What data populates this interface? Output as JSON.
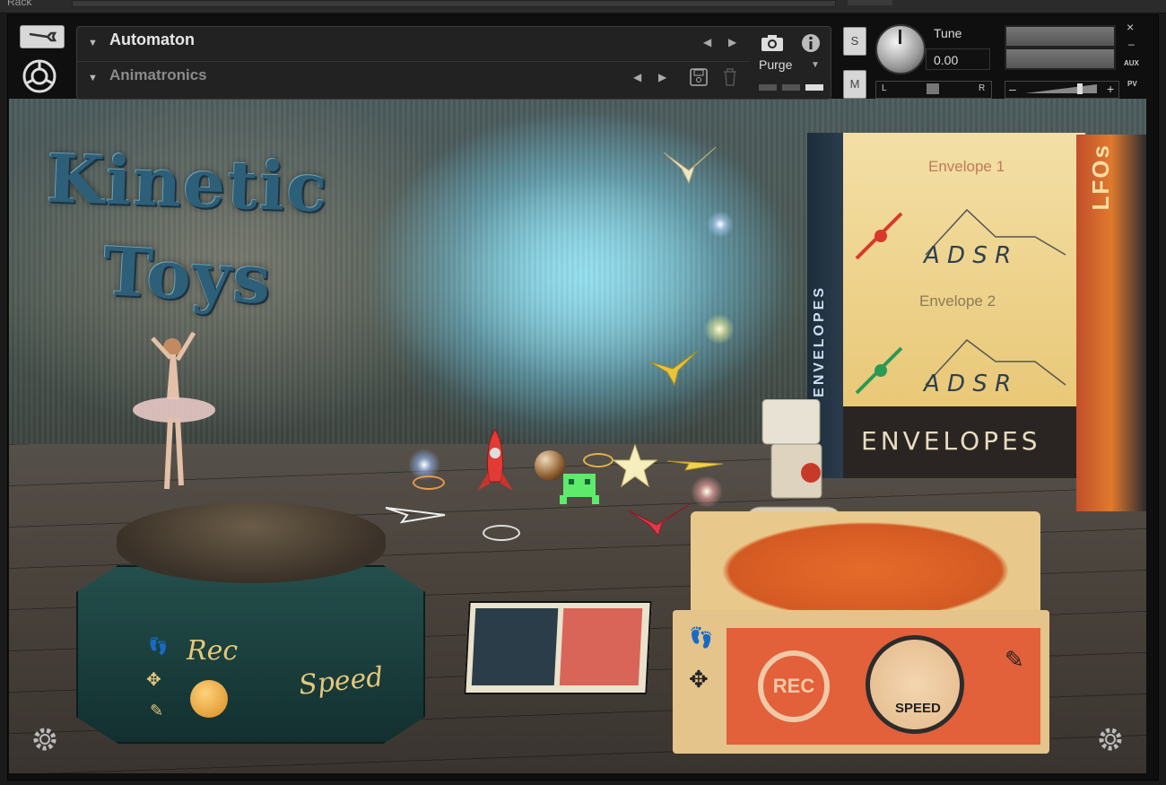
{
  "rack": {
    "label": "Rack"
  },
  "header": {
    "instrument_name": "Automaton",
    "snapshot_name": "Animatronics",
    "purge_label": "Purge",
    "solo_label": "S",
    "mute_label": "M",
    "tune_label": "Tune",
    "tune_value": "0.00",
    "pan_left": "L",
    "pan_right": "R",
    "vol_minus": "–",
    "vol_plus": "+",
    "close_label": "×",
    "minimize_label": "–",
    "aux_label": "AUX",
    "pv_label": "PV"
  },
  "scene": {
    "title_line1": "Kinetic",
    "title_line2": "Toys",
    "envelopes_book": {
      "spine_text": "ENVELOPES",
      "bottom_text": "ENVELOPES",
      "envelope1_label": "Envelope 1",
      "envelope2_label": "Envelope 2",
      "adsr_letters": "A D S R"
    },
    "lfos_book": {
      "spine_text": "LFOs"
    },
    "music_box": {
      "rec_label": "Rec",
      "speed_label": "Speed"
    },
    "robot_box": {
      "rec_label": "REC",
      "speed_label": "SPEED"
    }
  },
  "colors": {
    "accent_envelope1": "#d9392a",
    "accent_envelope2": "#2a9a55",
    "title": "#2e5f78"
  },
  "icons": [
    "wrench-icon",
    "settings-logo-icon",
    "camera-icon",
    "info-icon",
    "save-icon",
    "trash-icon",
    "gear-icon"
  ]
}
